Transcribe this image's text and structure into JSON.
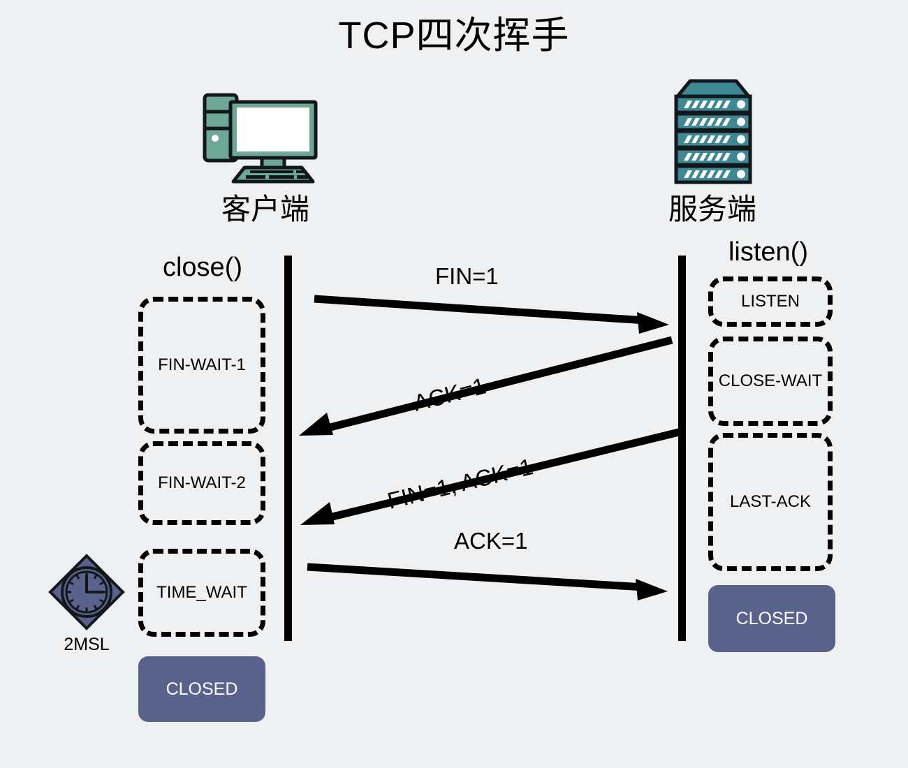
{
  "title": "TCP四次挥手",
  "colors": {
    "background": "#eff0f2",
    "line": "#000000",
    "client_icon": "#6fa795",
    "server_icon": "#3e8894",
    "closed_fill": "#59628a",
    "closed_text": "#ffffff",
    "msl_fill": "#59628a"
  },
  "client": {
    "icon": "desktop-computer-icon",
    "label": "客户端",
    "call_label": "close()",
    "states": [
      {
        "name": "FIN-WAIT-1",
        "style": "dashed"
      },
      {
        "name": "FIN-WAIT-2",
        "style": "dashed"
      },
      {
        "name": "TIME_WAIT",
        "style": "dashed"
      },
      {
        "name": "CLOSED",
        "style": "solid"
      }
    ],
    "timer": {
      "icon": "clock-icon",
      "label": "2MSL"
    }
  },
  "server": {
    "icon": "server-rack-icon",
    "label": "服务端",
    "call_label": "listen()",
    "states": [
      {
        "name": "LISTEN",
        "style": "dashed"
      },
      {
        "name": "CLOSE-WAIT",
        "style": "dashed"
      },
      {
        "name": "LAST-ACK",
        "style": "dashed"
      },
      {
        "name": "CLOSED",
        "style": "solid"
      }
    ]
  },
  "messages": [
    {
      "label": "FIN=1",
      "direction": "client-to-server",
      "order": 1
    },
    {
      "label": "ACK=1",
      "direction": "server-to-client",
      "order": 2
    },
    {
      "label": "FIN=1, ACK=1",
      "direction": "server-to-client",
      "order": 3
    },
    {
      "label": "ACK=1",
      "direction": "client-to-server",
      "order": 4
    }
  ]
}
